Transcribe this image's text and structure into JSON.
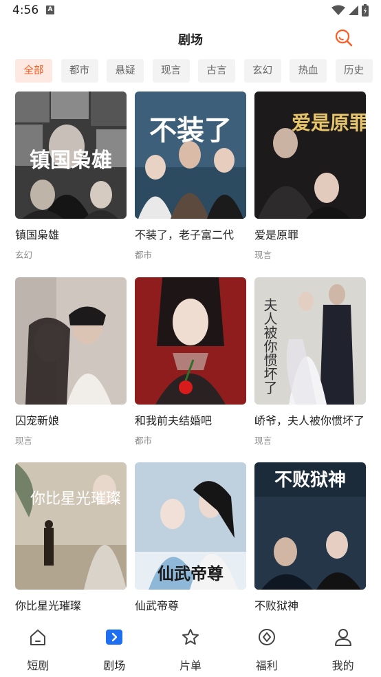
{
  "status_bar": {
    "time": "4:56",
    "notification_badge": "A"
  },
  "header": {
    "title": "剧场"
  },
  "colors": {
    "accent": "#ff5a1f",
    "accent_bg": "#fde9e1",
    "nav_active": "#1e6ff0"
  },
  "tabs": [
    {
      "label": "全部",
      "active": true
    },
    {
      "label": "都市"
    },
    {
      "label": "悬疑"
    },
    {
      "label": "现言"
    },
    {
      "label": "古言"
    },
    {
      "label": "玄幻"
    },
    {
      "label": "热血"
    },
    {
      "label": "历史"
    }
  ],
  "dramas": [
    {
      "title": "镇国枭雄",
      "tag": "玄幻",
      "cover_text": "镇国枭雄"
    },
    {
      "title": "不装了，老子富二代",
      "tag": "都市",
      "cover_text": "不装了"
    },
    {
      "title": "爱是原罪",
      "tag": "现言",
      "cover_text": "爱是原罪"
    },
    {
      "title": "囚宠新娘",
      "tag": "现言"
    },
    {
      "title": "和我前夫结婚吧",
      "tag": "都市"
    },
    {
      "title": "峤爷，夫人被你惯坏了",
      "tag": "现言",
      "cover_text": "夫人被你惯坏了"
    },
    {
      "title": "你比星光璀璨",
      "tag": "",
      "cover_text": "你比星光璀璨"
    },
    {
      "title": "仙武帝尊",
      "tag": "",
      "cover_text": "仙武帝尊"
    },
    {
      "title": "不败狱神",
      "tag": "",
      "cover_text": "不败狱神"
    }
  ],
  "bottom_nav": [
    {
      "label": "短剧",
      "icon": "home-icon"
    },
    {
      "label": "剧场",
      "icon": "theater-icon",
      "active": true
    },
    {
      "label": "片单",
      "icon": "star-icon"
    },
    {
      "label": "福利",
      "icon": "gift-diamond-icon"
    },
    {
      "label": "我的",
      "icon": "person-icon"
    }
  ]
}
